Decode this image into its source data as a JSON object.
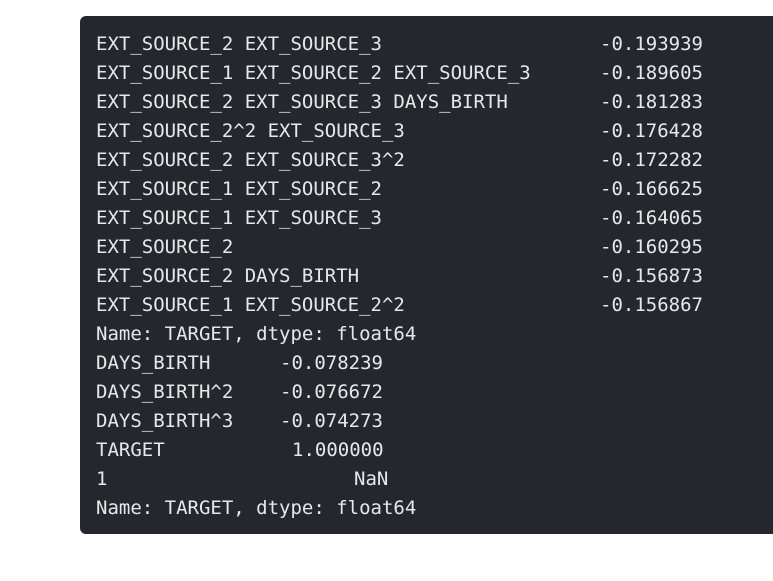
{
  "output": {
    "correlations_top": [
      {
        "feature": "EXT_SOURCE_2 EXT_SOURCE_3",
        "value": "-0.193939"
      },
      {
        "feature": "EXT_SOURCE_1 EXT_SOURCE_2 EXT_SOURCE_3",
        "value": "-0.189605"
      },
      {
        "feature": "EXT_SOURCE_2 EXT_SOURCE_3 DAYS_BIRTH",
        "value": "-0.181283"
      },
      {
        "feature": "EXT_SOURCE_2^2 EXT_SOURCE_3",
        "value": "-0.176428"
      },
      {
        "feature": "EXT_SOURCE_2 EXT_SOURCE_3^2",
        "value": "-0.172282"
      },
      {
        "feature": "EXT_SOURCE_1 EXT_SOURCE_2",
        "value": "-0.166625"
      },
      {
        "feature": "EXT_SOURCE_1 EXT_SOURCE_3",
        "value": "-0.164065"
      },
      {
        "feature": "EXT_SOURCE_2",
        "value": "-0.160295"
      },
      {
        "feature": "EXT_SOURCE_2 DAYS_BIRTH",
        "value": "-0.156873"
      },
      {
        "feature": "EXT_SOURCE_1 EXT_SOURCE_2^2",
        "value": "-0.156867"
      }
    ],
    "series_footer_1": "Name: TARGET, dtype: float64",
    "correlations_bottom": [
      {
        "feature": "DAYS_BIRTH",
        "value": "-0.078239"
      },
      {
        "feature": "DAYS_BIRTH^2",
        "value": "-0.076672"
      },
      {
        "feature": "DAYS_BIRTH^3",
        "value": "-0.074273"
      },
      {
        "feature": "TARGET",
        "value": "1.000000"
      },
      {
        "feature": "1",
        "value": "NaN"
      }
    ],
    "series_footer_2": "Name: TARGET, dtype: float64"
  },
  "colors": {
    "background": "#24272d",
    "text": "#e8e8e8",
    "page": "#ffffff"
  }
}
